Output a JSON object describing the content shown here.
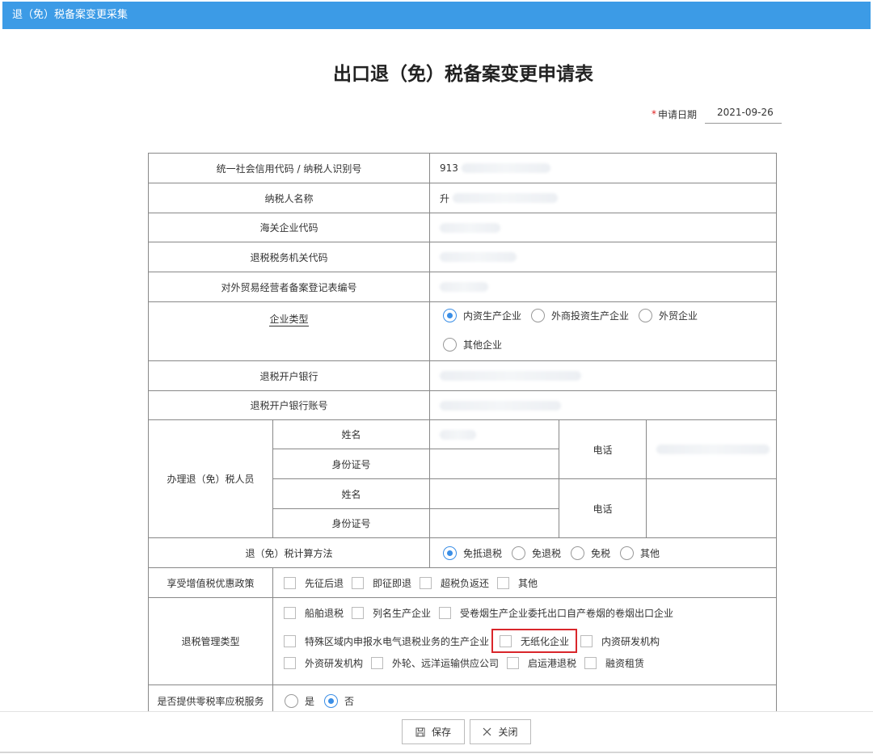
{
  "window": {
    "title": "退（免）税备案变更采集"
  },
  "form": {
    "title": "出口退（免）税备案变更申请表",
    "apply_date_label": "申请日期",
    "apply_date_value": "2021-09-26"
  },
  "rows": {
    "credit_code_label": "统一社会信用代码 / 纳税人识别号",
    "credit_code_value": "913",
    "taxpayer_name_label": "纳税人名称",
    "taxpayer_name_value": "升",
    "customs_code_label": "海关企业代码",
    "tax_office_label": "退税税务机关代码",
    "trade_reg_label": "对外贸易经营者备案登记表编号",
    "enterprise_type_label": "企业类型",
    "enterprise_types": [
      "内资生产企业",
      "外商投资生产企业",
      "外贸企业",
      "其他企业"
    ],
    "enterprise_type_selected": "内资生产企业",
    "bank_label": "退税开户银行",
    "bank_account_label": "退税开户银行账号",
    "staff_label": "办理退（免）税人员",
    "name_label_1": "姓名",
    "id_label_1": "身份证号",
    "name_label_2": "姓名",
    "id_label_2": "身份证号",
    "phone_label_1": "电话",
    "phone_label_2": "电话",
    "calc_method_label": "退（免）税计算方法",
    "calc_methods": [
      "免抵退税",
      "免退税",
      "免税",
      "其他"
    ],
    "calc_method_selected": "免抵退税",
    "vat_policy_label": "享受增值税优惠政策",
    "vat_policies": [
      "先征后退",
      "即征即退",
      "超税负返还",
      "其他"
    ],
    "mgmt_type_label": "退税管理类型",
    "mgmt_types_row1": [
      "船舶退税",
      "列名生产企业",
      "受卷烟生产企业委托出口自产卷烟的卷烟出口企业"
    ],
    "mgmt_types_row2": [
      "特殊区域内申报水电气退税业务的生产企业",
      "无纸化企业",
      "内资研发机构"
    ],
    "mgmt_types_row3": [
      "外资研发机构",
      "外轮、远洋运输供应公司",
      "启运港退税",
      "融资租赁"
    ],
    "zero_rate_label": "是否提供零税率应税服务",
    "zero_rate_options": [
      "是",
      "否"
    ],
    "zero_rate_selected": "否"
  },
  "buttons": {
    "save": "保存",
    "close": "关闭"
  },
  "icons": {
    "save": "save-icon",
    "close": "close-icon"
  },
  "colors": {
    "titlebar": "#3c9be6",
    "radio_checked": "#3a8ee6",
    "highlight": "#d9262b"
  }
}
